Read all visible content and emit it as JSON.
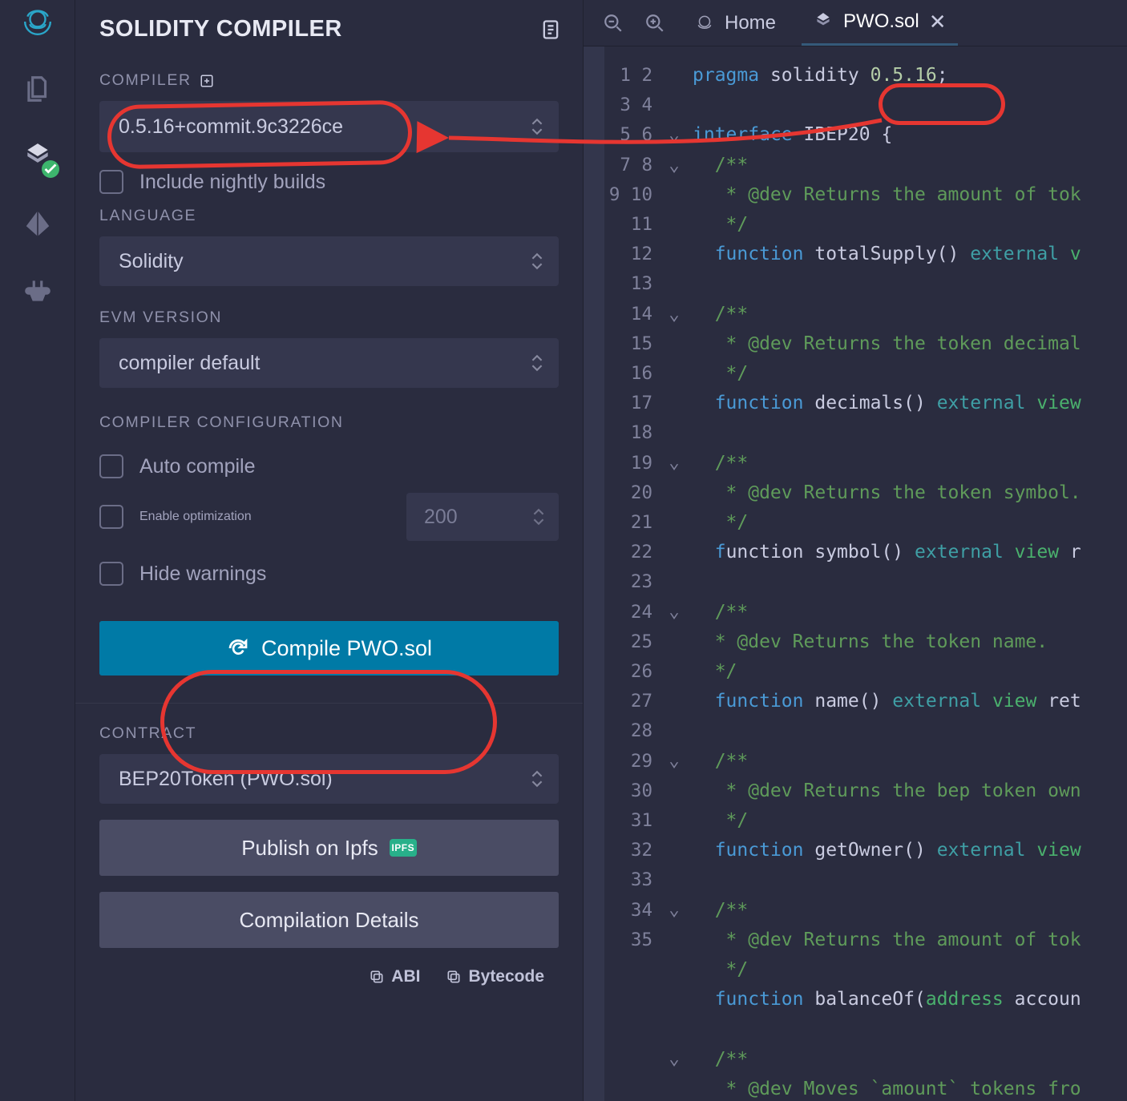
{
  "panel": {
    "title": "SOLIDITY COMPILER",
    "labels": {
      "compiler": "COMPILER",
      "language": "LANGUAGE",
      "evm": "EVM VERSION",
      "config": "COMPILER CONFIGURATION",
      "contract": "CONTRACT"
    },
    "selects": {
      "compiler": "0.5.16+commit.9c3226ce",
      "language": "Solidity",
      "evm": "compiler default",
      "contract": "BEP20Token (PWO.sol)"
    },
    "checks": {
      "nightly": "Include nightly builds",
      "auto": "Auto compile",
      "optimize": "Enable optimization",
      "hide": "Hide warnings"
    },
    "optimize_runs": "200",
    "buttons": {
      "compile": "Compile PWO.sol",
      "ipfs": "Publish on Ipfs",
      "ipfs_badge": "IPFS",
      "details": "Compilation Details",
      "abi": "ABI",
      "bytecode": "Bytecode"
    }
  },
  "tabs": {
    "home": "Home",
    "file": "PWO.sol"
  },
  "code": {
    "lines": [
      [
        [
          "kw",
          "pragma"
        ],
        [
          "",
          ""
        ],
        [
          "ident",
          "solidity"
        ],
        [
          "",
          ""
        ],
        [
          "num",
          "0.5.16"
        ],
        [
          "punc",
          ";"
        ]
      ],
      [],
      [
        [
          "kw",
          "interface"
        ],
        [
          "",
          ""
        ],
        [
          "ident",
          "IBEP20"
        ],
        [
          "",
          ""
        ],
        [
          "punc",
          "{"
        ]
      ],
      [
        [
          "",
          "  "
        ],
        [
          "cmt",
          "/**"
        ]
      ],
      [
        [
          "",
          "   "
        ],
        [
          "cmt",
          "* @dev Returns the amount of tok"
        ]
      ],
      [
        [
          "",
          "   "
        ],
        [
          "cmt",
          "*/"
        ]
      ],
      [
        [
          "",
          "  "
        ],
        [
          "kw",
          "function"
        ],
        [
          "",
          ""
        ],
        [
          "ident",
          "totalSupply"
        ],
        [
          "punc",
          "()"
        ],
        [
          "",
          ""
        ],
        [
          "extern",
          "external"
        ],
        [
          "",
          ""
        ],
        [
          "type",
          "v"
        ]
      ],
      [],
      [
        [
          "",
          "  "
        ],
        [
          "cmt",
          "/**"
        ]
      ],
      [
        [
          "",
          "   "
        ],
        [
          "cmt",
          "* @dev Returns the token decimal"
        ]
      ],
      [
        [
          "",
          "   "
        ],
        [
          "cmt",
          "*/"
        ]
      ],
      [
        [
          "",
          "  "
        ],
        [
          "kw",
          "function"
        ],
        [
          "",
          ""
        ],
        [
          "ident",
          "decimals"
        ],
        [
          "punc",
          "()"
        ],
        [
          "",
          ""
        ],
        [
          "extern",
          "external"
        ],
        [
          "",
          ""
        ],
        [
          "type",
          "view"
        ]
      ],
      [],
      [
        [
          "",
          "  "
        ],
        [
          "cmt",
          "/**"
        ]
      ],
      [
        [
          "",
          "   "
        ],
        [
          "cmt",
          "* @dev Returns the token symbol."
        ]
      ],
      [
        [
          "",
          "   "
        ],
        [
          "cmt",
          "*/"
        ]
      ],
      [
        [
          "",
          "  "
        ],
        [
          "kw",
          "f"
        ],
        [
          "ident",
          "unction"
        ],
        [
          "",
          ""
        ],
        [
          "ident",
          "symbol"
        ],
        [
          "punc",
          "()"
        ],
        [
          "",
          ""
        ],
        [
          "extern",
          "external"
        ],
        [
          "",
          ""
        ],
        [
          "type",
          "view"
        ],
        [
          "",
          ""
        ],
        [
          "ident",
          "r"
        ]
      ],
      [],
      [
        [
          "",
          "  "
        ],
        [
          "cmt",
          "/**"
        ]
      ],
      [
        [
          "",
          "  "
        ],
        [
          "cmt",
          "* @dev Returns the token name."
        ]
      ],
      [
        [
          "",
          "  "
        ],
        [
          "cmt",
          "*/"
        ]
      ],
      [
        [
          "",
          "  "
        ],
        [
          "kw",
          "function"
        ],
        [
          "",
          ""
        ],
        [
          "ident",
          "name"
        ],
        [
          "punc",
          "()"
        ],
        [
          "",
          ""
        ],
        [
          "extern",
          "external"
        ],
        [
          "",
          ""
        ],
        [
          "type",
          "view"
        ],
        [
          "",
          ""
        ],
        [
          "ident",
          "ret"
        ]
      ],
      [],
      [
        [
          "",
          "  "
        ],
        [
          "cmt",
          "/**"
        ]
      ],
      [
        [
          "",
          "   "
        ],
        [
          "cmt",
          "* @dev Returns the bep token own"
        ]
      ],
      [
        [
          "",
          "   "
        ],
        [
          "cmt",
          "*/"
        ]
      ],
      [
        [
          "",
          "  "
        ],
        [
          "kw",
          "function"
        ],
        [
          "",
          ""
        ],
        [
          "ident",
          "getOwner"
        ],
        [
          "punc",
          "()"
        ],
        [
          "",
          ""
        ],
        [
          "extern",
          "external"
        ],
        [
          "",
          ""
        ],
        [
          "type",
          "view"
        ]
      ],
      [],
      [
        [
          "",
          "  "
        ],
        [
          "cmt",
          "/**"
        ]
      ],
      [
        [
          "",
          "   "
        ],
        [
          "cmt",
          "* @dev Returns the amount of tok"
        ]
      ],
      [
        [
          "",
          "   "
        ],
        [
          "cmt",
          "*/"
        ]
      ],
      [
        [
          "",
          "  "
        ],
        [
          "kw",
          "function"
        ],
        [
          "",
          ""
        ],
        [
          "ident",
          "balanceOf"
        ],
        [
          "punc",
          "("
        ],
        [
          "type",
          "address"
        ],
        [
          "",
          ""
        ],
        [
          "ident",
          "accoun"
        ]
      ],
      [],
      [
        [
          "",
          "  "
        ],
        [
          "cmt",
          "/**"
        ]
      ],
      [
        [
          "",
          "   "
        ],
        [
          "cmt",
          "* @dev Moves `amount` tokens fro"
        ]
      ]
    ],
    "fold_markers": {
      "3": "v",
      "4": "v",
      "9": "v",
      "14": "v",
      "19": "v",
      "24": "v",
      "29": "v",
      "34": "v"
    }
  },
  "colors": {
    "accent": "#007aa6",
    "annot": "#e63631"
  }
}
